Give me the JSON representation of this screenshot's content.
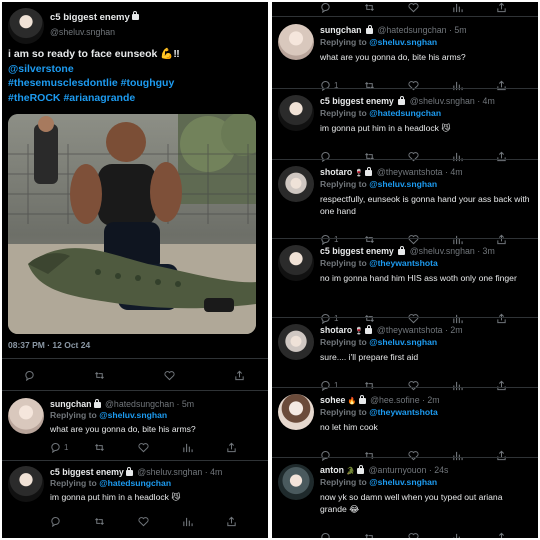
{
  "main_tweet": {
    "name": "c5 biggest enemy",
    "handle": "@sheluv.snghan",
    "text_main": "i am so ready to face eunseok",
    "text_emojis": "💪‼",
    "hashtags": [
      "@silverstone",
      "#thesemusclesdontlie",
      "#toughguy",
      "#theROCK",
      "#arianagrande"
    ],
    "timestamp": "08:37 PM · 12 Oct 24"
  },
  "left_replies": [
    {
      "name": "sungchan",
      "handle": "@hatedsungchan · 5m",
      "reply_label": "Replying to",
      "reply_to": "@sheluv.snghan",
      "text": "what are you gonna do, bite his arms?",
      "reply_count": "1",
      "avatar": "av-light"
    },
    {
      "name": "c5 biggest enemy",
      "handle": "@sheluv.snghan · 4m",
      "reply_label": "Replying to",
      "reply_to": "@hatedsungchan",
      "text": "im gonna put him in a headlock 😼",
      "reply_count": "",
      "avatar": "av-dark"
    }
  ],
  "right_tweets": [
    {
      "name": "sungchan",
      "emoji": "",
      "handle": "@hatedsungchan · 5m",
      "reply_label": "Replying to",
      "reply_to": "@sheluv.snghan",
      "text": "what are you gonna do, bite his arms?",
      "reply_count": "1",
      "avatar": "av-light"
    },
    {
      "name": "c5 biggest enemy",
      "emoji": "",
      "handle": "@sheluv.snghan · 4m",
      "reply_label": "Replying to",
      "reply_to": "@hatedsungchan",
      "text": "im gonna put him in a headlock 😼",
      "reply_count": "",
      "avatar": "av-dark"
    },
    {
      "name": "shotaro",
      "emoji": "🍷",
      "handle": "@theywantshota · 4m",
      "reply_label": "Replying to",
      "reply_to": "@sheluv.snghan",
      "text": "respectfully, eunseok is gonna hand your ass back with one hand",
      "reply_count": "1",
      "avatar": "av-hat"
    },
    {
      "name": "c5 biggest enemy",
      "emoji": "",
      "handle": "@sheluv.snghan · 3m",
      "reply_label": "Replying to",
      "reply_to": "@theywantshota",
      "text": "no im gonna hand him HIS ass woth only one finger",
      "reply_count": "1",
      "avatar": "av-dark"
    },
    {
      "name": "shotaro",
      "emoji": "🍷",
      "handle": "@theywantshota · 2m",
      "reply_label": "Replying to",
      "reply_to": "@sheluv.snghan",
      "text": "sure.... i'll prepare first aid",
      "reply_count": "1",
      "avatar": "av-hat"
    },
    {
      "name": "sohee",
      "emoji": "🔥",
      "handle": "@hee.sofine · 2m",
      "reply_label": "Replying to",
      "reply_to": "@theywantshota",
      "text": "no let him cook",
      "reply_count": "",
      "avatar": "av-beige"
    },
    {
      "name": "anton",
      "emoji": "🐊",
      "handle": "@anturnyouon · 24s",
      "reply_label": "Replying to",
      "reply_to": "@sheluv.snghan",
      "text": "now yk so damn well when you typed out ariana grande 😂",
      "reply_count": "",
      "avatar": "av-teal"
    }
  ]
}
